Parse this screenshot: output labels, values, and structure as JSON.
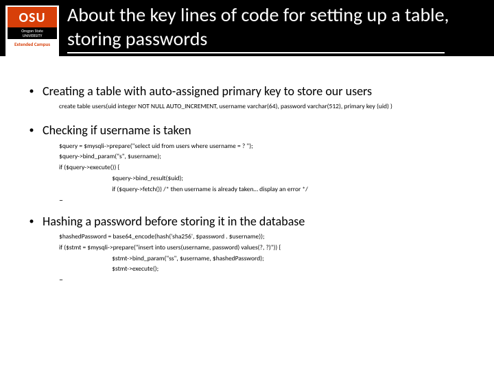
{
  "logo": {
    "abbr": "OSU",
    "name_line1": "Oregon State",
    "name_line2": "UNIVERSITY",
    "sub": "Extended Campus"
  },
  "title": "About the key lines of code for setting up a table, storing passwords",
  "sections": [
    {
      "heading": "Creating a table with auto-assigned primary key to store our users",
      "code": [
        "create table users(uid integer NOT NULL AUTO_INCREMENT, username varchar(64), password varchar(512), primary key (uid) )"
      ],
      "has_dash": false
    },
    {
      "heading": "Checking if username is taken",
      "code": [
        "$query = $mysqli->prepare(\"select uid from users where username = ? \");",
        "$query->bind_param(\"s\", $username);",
        "if ($query->execute()) {",
        "        $query->bind_result($uid);",
        "        if ($query->fetch()) /* then username is already taken… display an error */"
      ],
      "has_dash": true
    },
    {
      "heading": "Hashing a password before storing it in the database",
      "code": [
        "$hashedPassword = base64_encode(hash('sha256', $password . $username));",
        "if ($stmt = $mysqli->prepare(\"insert into users(username, password) values(?, ?)\")) {",
        "        $stmt->bind_param(\"ss\", $username, $hashedPassword);",
        "        $stmt->execute();"
      ],
      "has_dash": true
    }
  ]
}
